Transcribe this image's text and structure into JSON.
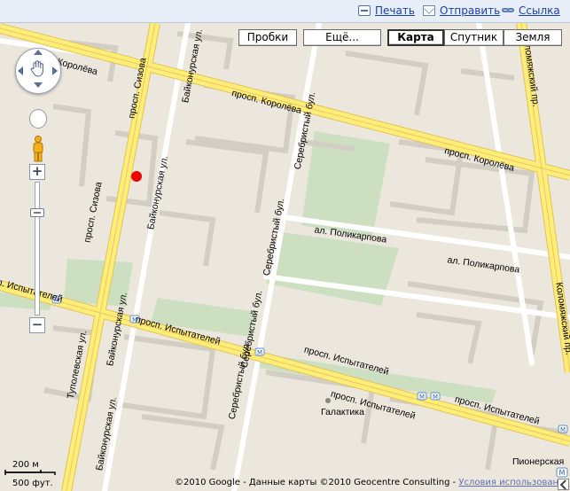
{
  "toolbar": {
    "print_label": "Печать",
    "send_label": "Отправить",
    "link_label": "Ссылка"
  },
  "map_buttons": {
    "traffic": "Пробки",
    "more": "Ещё...",
    "map": "Карта",
    "satellite": "Спутник",
    "terrain": "Земля"
  },
  "streets": {
    "koroleva_1": "просп. Королёва",
    "koroleva_2": "просп. Королёва",
    "koroleva_3": "просп. Королёва",
    "sizova_1": "просп. Сизова",
    "sizova_2": "просп. Сизова",
    "baikonurskaya_1": "Байконурская ул.",
    "baikonurskaya_2": "Байконурская ул.",
    "baikonurskaya_3": "Байконурская ул.",
    "baikonurskaya_4": "Байконурская ул.",
    "serebristy_1": "Серебристый бул.",
    "serebristy_2": "Серебристый бул.",
    "serebristy_3": "Серебристый бул.",
    "serebristy_4": "Серебристый бул.",
    "polikarpova_1": "ал. Поликарпова",
    "polikarpova_2": "ал. Поликарпова",
    "ispytateley_1": "просп. Испытателей",
    "ispytateley_2": "просп. Испытателей",
    "ispytateley_3": "просп. Испытателей",
    "ispytateley_4": "просп. Испытателей",
    "ispytateley_5": "просп. Испытателей",
    "tupolevskaya": "Туполевская ул.",
    "kolomyazhsky_1": "Коломяжский пр.",
    "kolomyazhsky_2": "Коломяжский пр."
  },
  "places": {
    "galaktika": "Галактика",
    "pionerskaya": "Пионерская"
  },
  "scale": {
    "metric": "200 м",
    "imperial": "500 фут."
  },
  "footer": {
    "copyright": "©2010 Google - Данные карты ©2010 Geocentre Consulting -",
    "terms": "Условия использования"
  },
  "colors": {
    "background": "#ece7dd",
    "road_major": "#ffed7a",
    "road_major_border": "#e2c255",
    "road_minor": "#ffffff",
    "park": "#cddfc1",
    "building": "#dedad2",
    "marker": "#ee0000"
  },
  "icons": [
    "print-icon",
    "mail-icon",
    "link-icon",
    "pan-hand-icon",
    "pegman-icon",
    "metro-icon",
    "zoom-in-icon",
    "zoom-out-icon"
  ]
}
